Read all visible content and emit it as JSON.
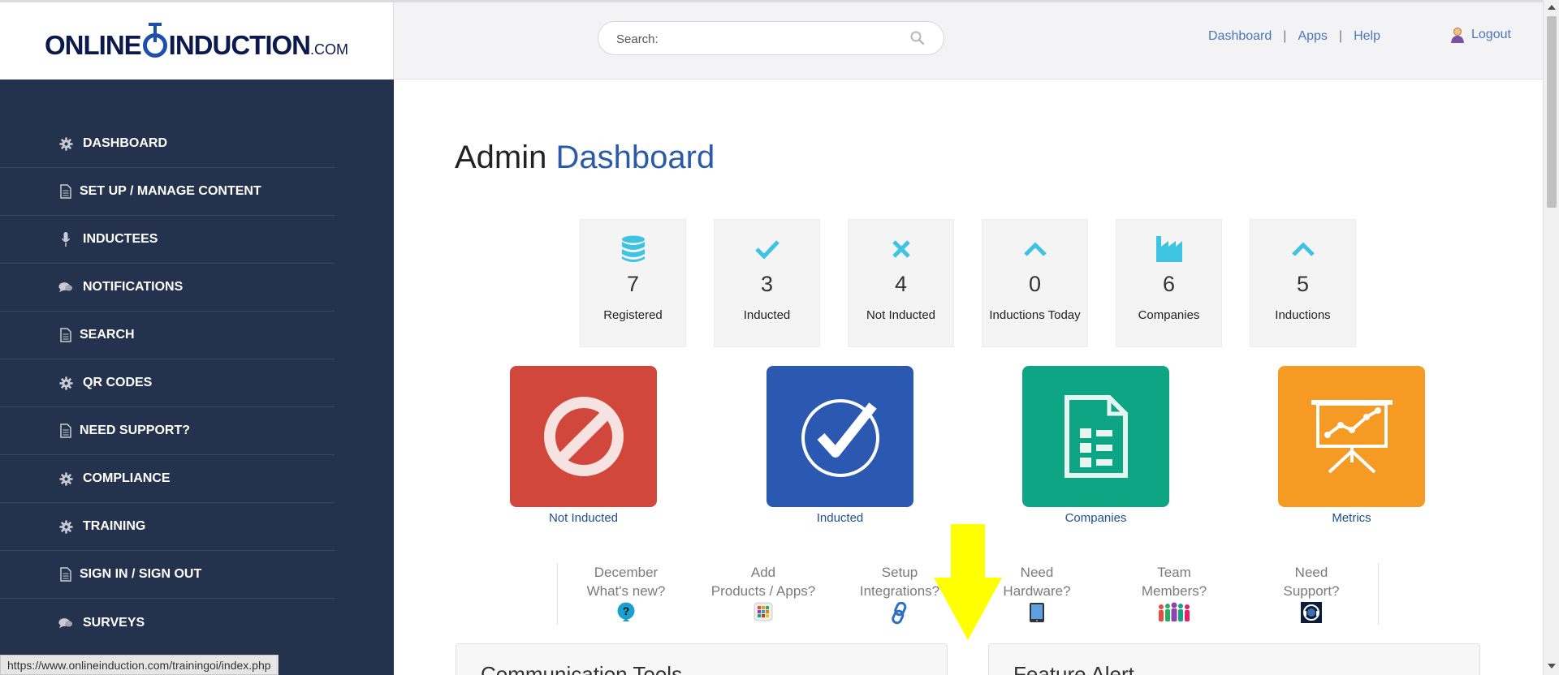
{
  "header": {
    "logo": {
      "main": "ONLINE",
      "after": "INDUCTION",
      "suffix": ".COM"
    },
    "search_placeholder": "Search:",
    "links": [
      "Dashboard",
      "Apps",
      "Help"
    ],
    "logout": "Logout"
  },
  "sidebar": {
    "items": [
      {
        "label": "DASHBOARD",
        "icon": "gear-icon"
      },
      {
        "label": "SET UP / MANAGE CONTENT",
        "icon": "document-icon"
      },
      {
        "label": "INDUCTEES",
        "icon": "microphone-icon"
      },
      {
        "label": "NOTIFICATIONS",
        "icon": "chat-icon"
      },
      {
        "label": "SEARCH",
        "icon": "document-icon"
      },
      {
        "label": "QR CODES",
        "icon": "gear-icon"
      },
      {
        "label": "NEED SUPPORT?",
        "icon": "document-icon"
      },
      {
        "label": "COMPLIANCE",
        "icon": "gear-icon"
      },
      {
        "label": "TRAINING",
        "icon": "gear-icon"
      },
      {
        "label": "SIGN IN / SIGN OUT",
        "icon": "document-icon"
      },
      {
        "label": "SURVEYS",
        "icon": "chat-icon"
      }
    ]
  },
  "statusbar_url": "https://www.onlineinduction.com/trainingoi/index.php",
  "main": {
    "title_plain": "Admin",
    "title_accent": "Dashboard",
    "stats": [
      {
        "value": "7",
        "label": "Registered",
        "icon": "database-icon"
      },
      {
        "value": "3",
        "label": "Inducted",
        "icon": "checkmark-icon"
      },
      {
        "value": "4",
        "label": "Not Inducted",
        "icon": "cross-icon"
      },
      {
        "value": "0",
        "label": "Inductions Today",
        "icon": "chevron-up-icon"
      },
      {
        "value": "6",
        "label": "Companies",
        "icon": "factory-icon"
      },
      {
        "value": "5",
        "label": "Inductions",
        "icon": "chevron-up-icon"
      }
    ],
    "tiles": [
      {
        "label": "Not Inducted",
        "color": "#d2473b",
        "icon": "prohibited-icon"
      },
      {
        "label": "Inducted",
        "color": "#2b58b0",
        "icon": "check-circle-icon"
      },
      {
        "label": "Companies",
        "color": "#0ea585",
        "icon": "document-list-icon"
      },
      {
        "label": "Metrics",
        "color": "#f59a23",
        "icon": "presentation-board-icon"
      }
    ],
    "help": [
      {
        "line1": "December",
        "line2": "What's new?",
        "icon": "question-icon"
      },
      {
        "line1": "Add",
        "line2": "Products / Apps?",
        "icon": "apps-grid-icon"
      },
      {
        "line1": "Setup",
        "line2": "Integrations?",
        "icon": "link-icon"
      },
      {
        "line1": "Need",
        "line2": "Hardware?",
        "icon": "tablet-icon"
      },
      {
        "line1": "Team",
        "line2": "Members?",
        "icon": "team-icon"
      },
      {
        "line1": "Need",
        "line2": "Support?",
        "icon": "headset-icon"
      }
    ],
    "panels": [
      "Communication Tools",
      "Feature Alert"
    ]
  },
  "colors": {
    "sidebar_bg": "#25324d",
    "stat_icon": "#3ec3e3",
    "accent": "#2a5aa8",
    "annotation_arrow": "#ffff00"
  }
}
